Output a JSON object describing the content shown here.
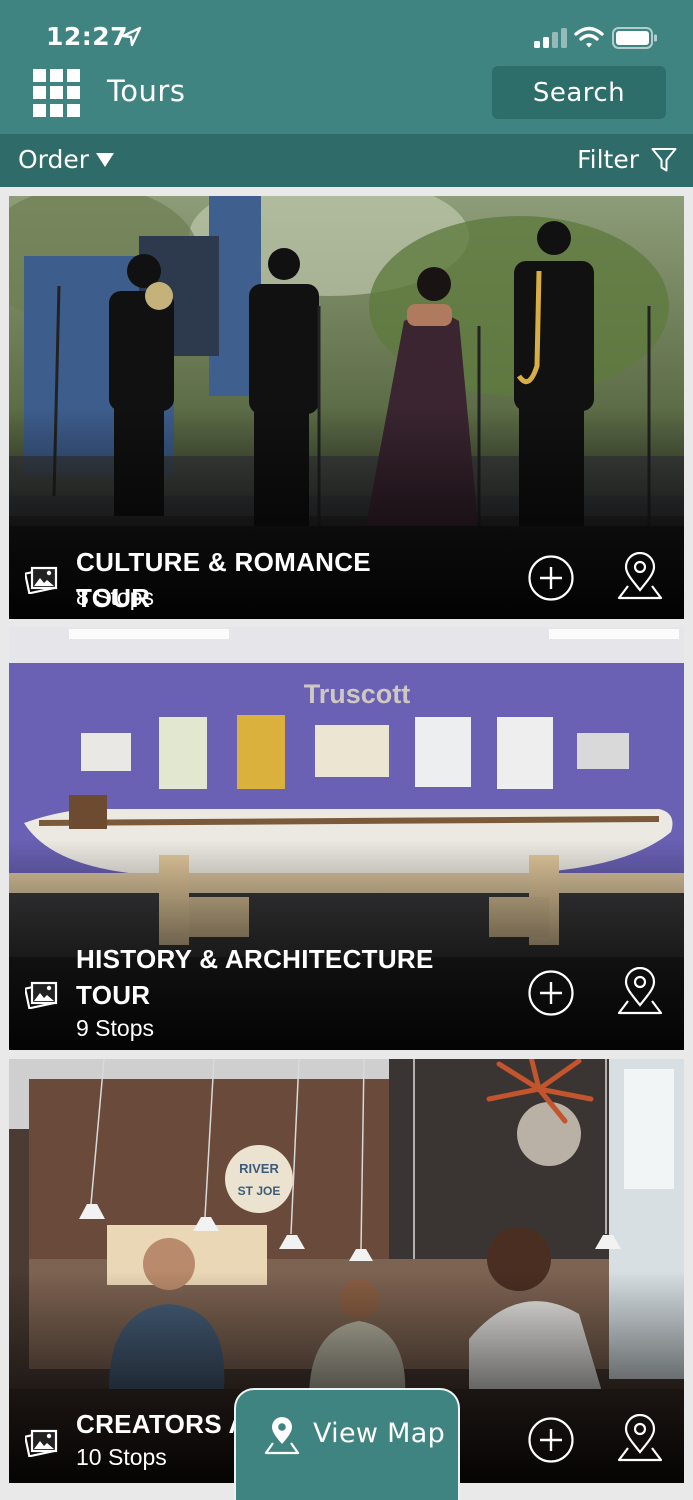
{
  "status_bar": {
    "time": "12:27"
  },
  "header": {
    "title": "Tours",
    "search_label": "Search"
  },
  "toolbar": {
    "order_label": "Order",
    "filter_label": "Filter"
  },
  "tours": [
    {
      "title": "CULTURE & ROMANCE TOUR",
      "stops": "8 Stops"
    },
    {
      "title": "HISTORY & ARCHITECTURE TOUR",
      "stops": "9 Stops"
    },
    {
      "title": "CREATORS A",
      "stops": "10 Stops"
    }
  ],
  "photos": {
    "museum_sign": "Truscott",
    "cafe_sign_1": "RIVER",
    "cafe_sign_2": "ST JOE"
  },
  "view_map_label": "View Map",
  "colors": {
    "header": "#3f8480",
    "subbar": "#2f6c69",
    "search_button": "#2d6e6a"
  }
}
